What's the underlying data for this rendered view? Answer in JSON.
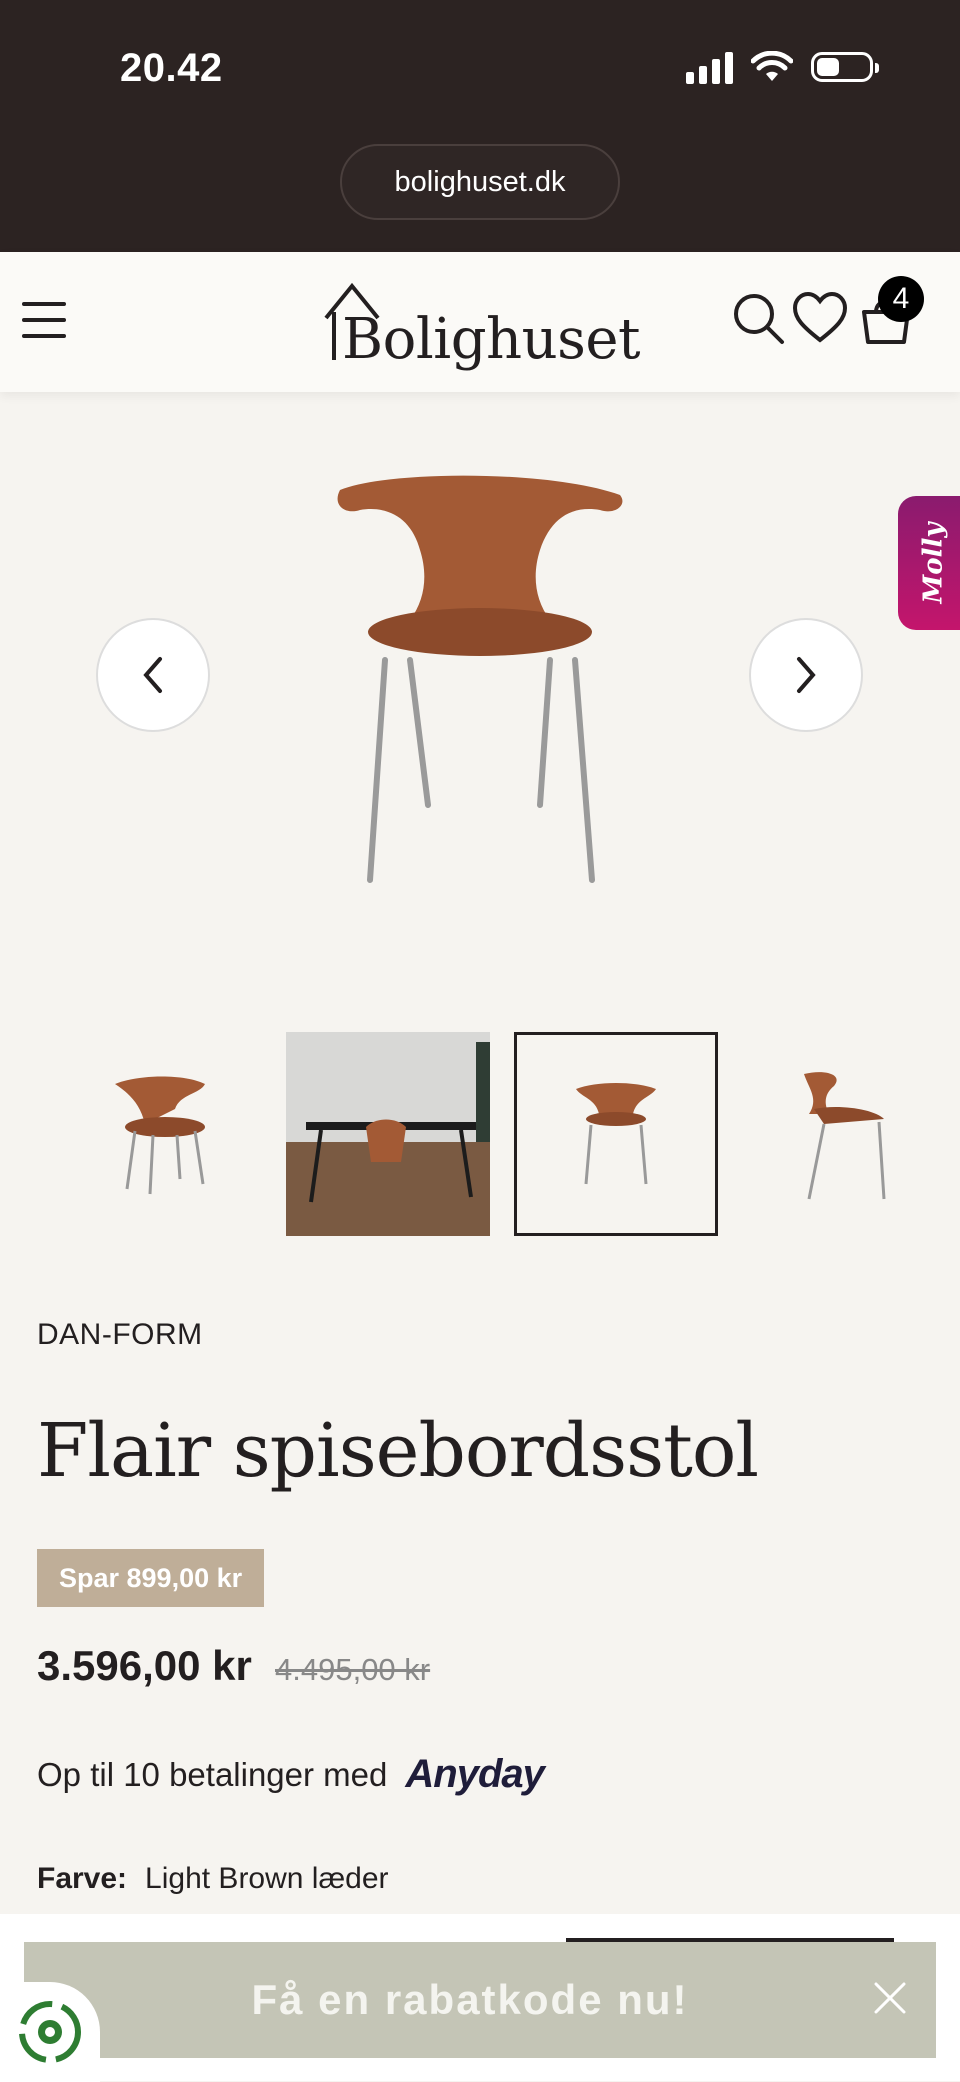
{
  "status_bar": {
    "time": "20.42"
  },
  "browser": {
    "url": "bolighuset.dk"
  },
  "header": {
    "logo": "Bolighuset",
    "cart_count": "4"
  },
  "gallery": {
    "thumbnails": [
      "chair-front-angle",
      "dining-room-scene",
      "chair-front",
      "chair-side"
    ],
    "active_index": 2,
    "assistant_tab": "Molly"
  },
  "product": {
    "brand": "DAN-FORM",
    "title": "Flair spisebordsstol",
    "save_badge": "Spar 899,00 kr",
    "price": "3.596,00 kr",
    "old_price": "4.495,00 kr",
    "installments_text": "Op til 10 betalinger med",
    "installments_provider": "Anyday",
    "color_label": "Farve:",
    "color_value": "Light Brown læder"
  },
  "promo": {
    "text": "Få en rabatkode nu!"
  },
  "colors": {
    "header_bg": "#2c2322",
    "page_bg": "#f6f4f0",
    "badge": "#bfae98",
    "promo": "#c4c5b6",
    "molly": "#c4156c"
  }
}
